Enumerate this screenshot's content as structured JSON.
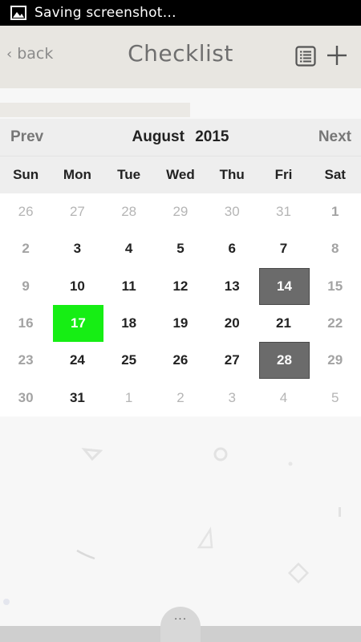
{
  "status_bar": {
    "text": "Saving screenshot…",
    "icon": "image-icon"
  },
  "header": {
    "back_label": "back",
    "title": "Checklist",
    "list_icon": "list-icon",
    "add_icon": "plus-icon"
  },
  "calendar": {
    "prev_label": "Prev",
    "next_label": "Next",
    "month": "August",
    "year": "2015",
    "weekdays": [
      "Sun",
      "Mon",
      "Tue",
      "Wed",
      "Thu",
      "Fri",
      "Sat"
    ],
    "weeks": [
      [
        {
          "d": "26",
          "o": true
        },
        {
          "d": "27",
          "o": true
        },
        {
          "d": "28",
          "o": true
        },
        {
          "d": "29",
          "o": true
        },
        {
          "d": "30",
          "o": true
        },
        {
          "d": "31",
          "o": true
        },
        {
          "d": "1",
          "o": false
        }
      ],
      [
        {
          "d": "2",
          "o": false
        },
        {
          "d": "3",
          "o": false
        },
        {
          "d": "4",
          "o": false
        },
        {
          "d": "5",
          "o": false
        },
        {
          "d": "6",
          "o": false
        },
        {
          "d": "7",
          "o": false
        },
        {
          "d": "8",
          "o": false
        }
      ],
      [
        {
          "d": "9",
          "o": false
        },
        {
          "d": "10",
          "o": false
        },
        {
          "d": "11",
          "o": false
        },
        {
          "d": "12",
          "o": false
        },
        {
          "d": "13",
          "o": false
        },
        {
          "d": "14",
          "o": false,
          "marked": true
        },
        {
          "d": "15",
          "o": false
        }
      ],
      [
        {
          "d": "16",
          "o": false
        },
        {
          "d": "17",
          "o": false,
          "today": true
        },
        {
          "d": "18",
          "o": false
        },
        {
          "d": "19",
          "o": false
        },
        {
          "d": "20",
          "o": false
        },
        {
          "d": "21",
          "o": false
        },
        {
          "d": "22",
          "o": false
        }
      ],
      [
        {
          "d": "23",
          "o": false
        },
        {
          "d": "24",
          "o": false
        },
        {
          "d": "25",
          "o": false
        },
        {
          "d": "26",
          "o": false
        },
        {
          "d": "27",
          "o": false
        },
        {
          "d": "28",
          "o": false,
          "marked": true
        },
        {
          "d": "29",
          "o": false
        }
      ],
      [
        {
          "d": "30",
          "o": false
        },
        {
          "d": "31",
          "o": false
        },
        {
          "d": "1",
          "o": true
        },
        {
          "d": "2",
          "o": true
        },
        {
          "d": "3",
          "o": true
        },
        {
          "d": "4",
          "o": true
        },
        {
          "d": "5",
          "o": true
        }
      ]
    ],
    "colors": {
      "today": "#16ee14",
      "marked": "#6b6b6b"
    }
  },
  "bottom": {
    "more_label": "···",
    "more_icon": "ellipsis-icon"
  }
}
